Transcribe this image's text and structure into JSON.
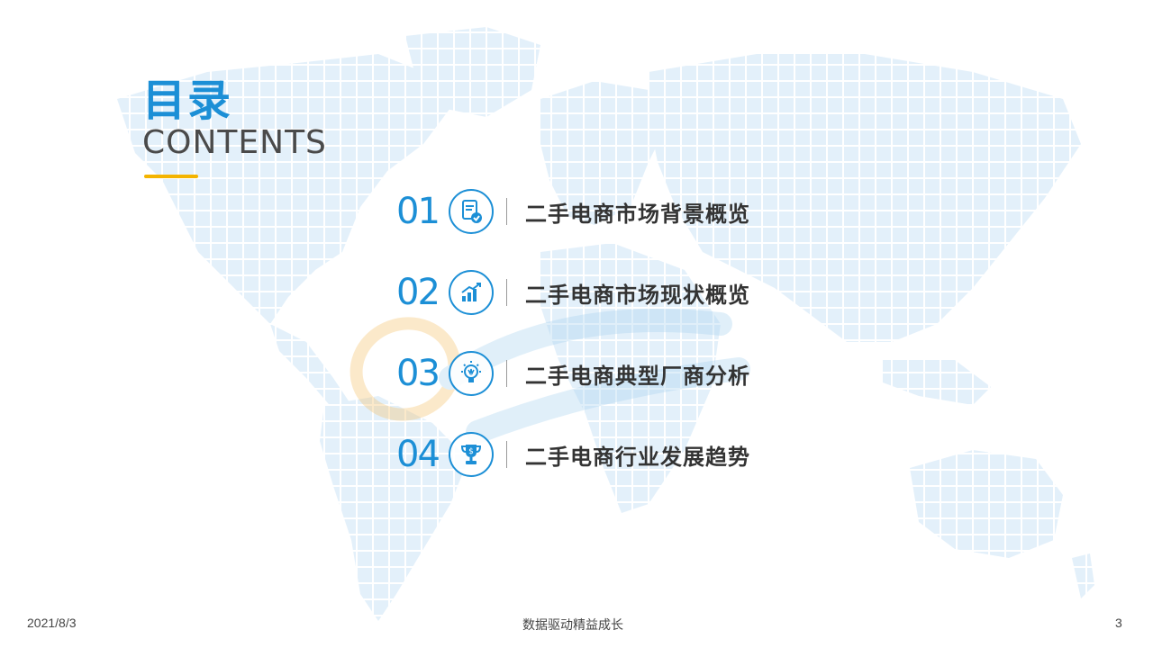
{
  "title": {
    "cn": "目录",
    "en": "CONTENTS"
  },
  "colors": {
    "accent": "#1c8fd6",
    "underline": "#f4b400",
    "text": "#333333"
  },
  "toc": [
    {
      "number": "01",
      "label": "二手电商市场背景概览",
      "icon": "document-check-icon"
    },
    {
      "number": "02",
      "label": "二手电商市场现状概览",
      "icon": "growth-chart-icon"
    },
    {
      "number": "03",
      "label": "二手电商典型厂商分析",
      "icon": "lightbulb-icon"
    },
    {
      "number": "04",
      "label": "二手电商行业发展趋势",
      "icon": "trophy-icon"
    }
  ],
  "footer": {
    "date": "2021/8/3",
    "slogan": "数据驱动精益成长",
    "page": "3"
  }
}
